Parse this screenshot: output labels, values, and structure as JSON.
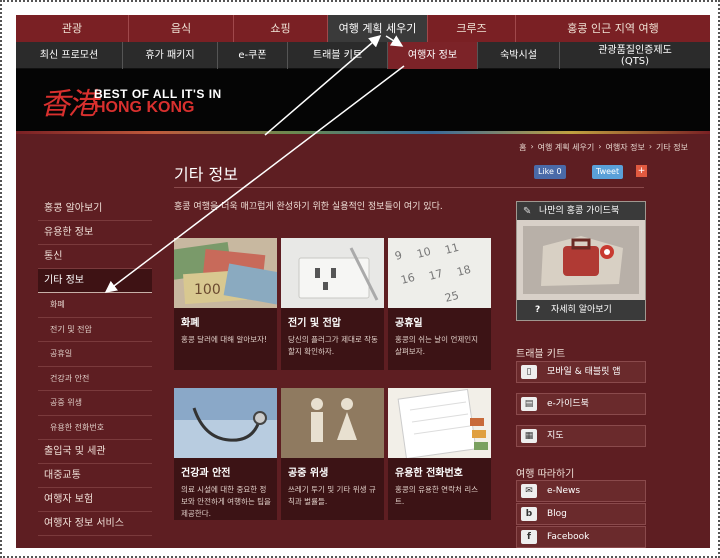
{
  "top_nav": [
    "관광",
    "음식",
    "쇼핑",
    "여행 계획 세우기",
    "크루즈",
    "홍콩 인근 지역 여행"
  ],
  "sub_nav": [
    "최신 프로모션",
    "휴가 패키지",
    "e-쿠폰",
    "트래블 키트",
    "여행자 정보",
    "숙박시설",
    "관광품질인증제도\n(QTS)"
  ],
  "logo": {
    "chinese": "香港",
    "line1": "BEST OF ALL IT'S IN",
    "line2": "HONG KONG"
  },
  "breadcrumb": [
    "홈",
    "›",
    "여행 계획 세우기",
    "›",
    "여행자 정보",
    "›",
    "기타 정보"
  ],
  "page_title": "기타 정보",
  "social": {
    "like": "Like 0",
    "tweet": "Tweet",
    "plus": "+"
  },
  "intro": "홍콩 여행을 더욱 매끄럽게 완성하기 위한 실용적인 정보들이 여기 있다.",
  "sidebar": [
    "홍콩 알아보기",
    "유용한 정보",
    "통신",
    "기타 정보",
    "화폐",
    "전기 및 전압",
    "공휴일",
    "건강과 안전",
    "공중 위생",
    "유용한 전화번호",
    "출입국 및 세관",
    "대중교통",
    "여행자 보험",
    "여행자 정보 서비스"
  ],
  "cards": [
    {
      "title": "화폐",
      "desc": "홍콩 달러에 대해 알아보자!"
    },
    {
      "title": "전기 및 전압",
      "desc": "당신의 플러그가 제대로 작동할지 확인하자."
    },
    {
      "title": "공휴일",
      "desc": "홍콩의 쉬는 날이 언제인지 살펴보자."
    },
    {
      "title": "건강과 안전",
      "desc": "의료 시설에 대한 중요한 정보와 안전하게 여행하는 팁을 제공한다."
    },
    {
      "title": "공중 위생",
      "desc": "쓰레기 투기 및 기타 위생 규칙과 벌률들."
    },
    {
      "title": "유용한 전화번호",
      "desc": "홍콩의 유용한 연락처 리스트."
    }
  ],
  "guide": {
    "title": "나만의 홍콩 가이드북",
    "more": "자세히 알아보기",
    "more_icon": "?"
  },
  "travel_kit": {
    "heading": "트래블 키트",
    "items": [
      "모바일 & 태블릿 앱",
      "e-가이드북",
      "지도"
    ]
  },
  "follow": {
    "heading": "여행 따라하기",
    "items": [
      "e-News",
      "Blog",
      "Facebook"
    ]
  },
  "colors": {
    "page_bg": "#5e1e22",
    "nav_red": "#7a2024",
    "sub_nav": "#2b2b2b",
    "accent_red": "#d8302e"
  }
}
